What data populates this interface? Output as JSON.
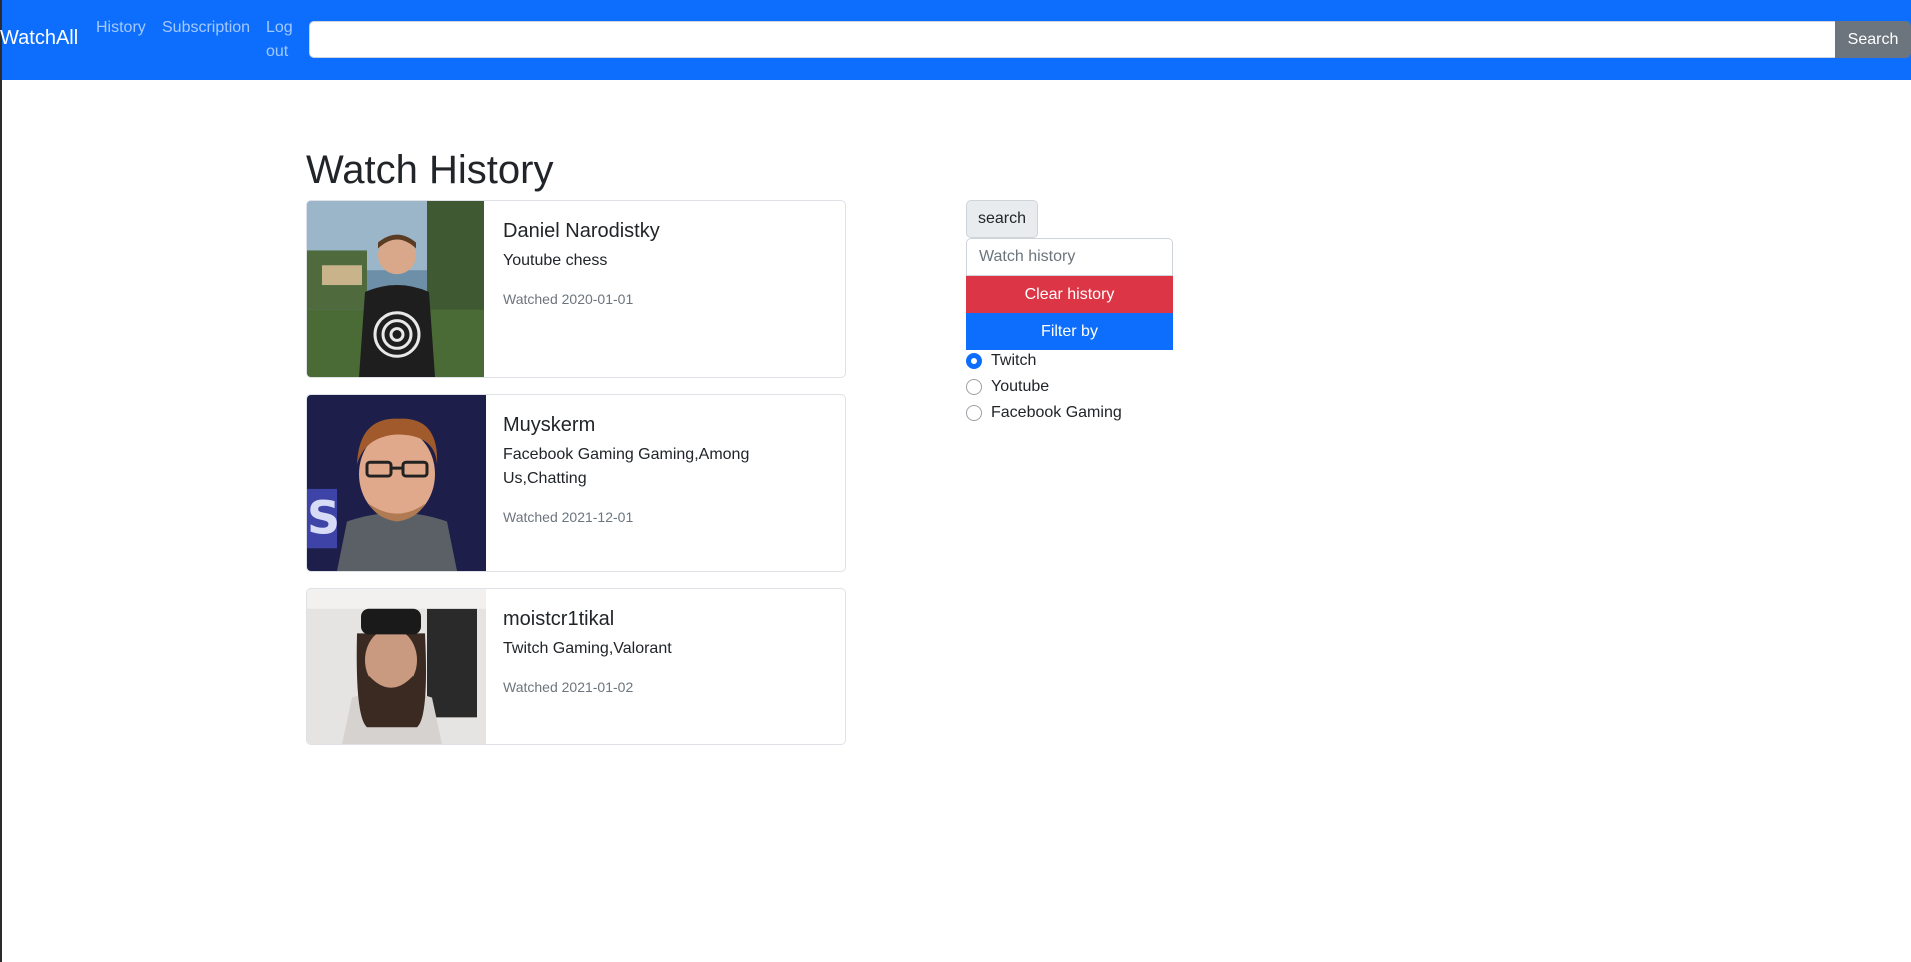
{
  "navbar": {
    "brand": "WatchAll",
    "links": [
      "History",
      "Subscription",
      "Log out"
    ],
    "search_placeholder": "",
    "search_button": "Search"
  },
  "page": {
    "title": "Watch History"
  },
  "history": [
    {
      "name": "Daniel Narodistky",
      "tags": "Youtube chess",
      "watched": "Watched 2020-01-01"
    },
    {
      "name": "Muyskerm",
      "tags": "Facebook Gaming Gaming,Among Us,Chatting",
      "watched": "Watched 2021-12-01"
    },
    {
      "name": "moistcr1tikal",
      "tags": "Twitch Gaming,Valorant",
      "watched": "Watched 2021-01-02"
    }
  ],
  "sidebar": {
    "search_button": "search",
    "input_placeholder": "Watch history",
    "clear_button": "Clear history",
    "filter_button": "Filter by",
    "filters": [
      {
        "label": "Twitch",
        "checked": true
      },
      {
        "label": "Youtube",
        "checked": false
      },
      {
        "label": "Facebook Gaming",
        "checked": false
      }
    ]
  },
  "colors": {
    "primary": "#0d6efd",
    "danger": "#dc3545",
    "secondary": "#6c757d"
  }
}
